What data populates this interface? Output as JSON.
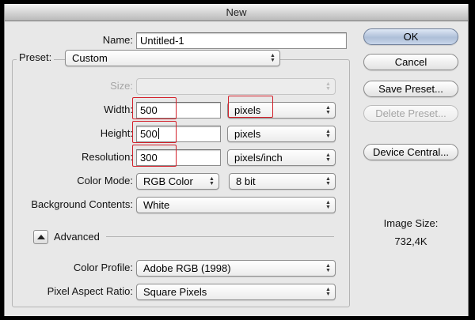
{
  "window": {
    "title": "New"
  },
  "name": {
    "label": "Name:",
    "value": "Untitled-1"
  },
  "preset": {
    "label": "Preset:",
    "value": "Custom"
  },
  "size": {
    "label": "Size:",
    "value": ""
  },
  "width": {
    "label": "Width:",
    "value": "500",
    "unit": "pixels"
  },
  "height": {
    "label": "Height:",
    "value": "500",
    "unit": "pixels"
  },
  "resolution": {
    "label": "Resolution:",
    "value": "300",
    "unit": "pixels/inch"
  },
  "color_mode": {
    "label": "Color Mode:",
    "mode": "RGB Color",
    "depth": "8 bit"
  },
  "background": {
    "label": "Background Contents:",
    "value": "White"
  },
  "advanced": {
    "label": "Advanced"
  },
  "color_profile": {
    "label": "Color Profile:",
    "value": "Adobe RGB (1998)"
  },
  "pixel_aspect": {
    "label": "Pixel Aspect Ratio:",
    "value": "Square Pixels"
  },
  "buttons": {
    "ok": "OK",
    "cancel": "Cancel",
    "save_preset": "Save Preset...",
    "delete_preset": "Delete Preset...",
    "device_central": "Device Central..."
  },
  "image_size": {
    "label": "Image Size:",
    "value": "732,4K"
  },
  "colors": {
    "highlight": "#d3202a",
    "dialog_bg": "#e8e8e8",
    "frame": "#000000"
  },
  "icons": {
    "popup_arrows": "up-down-arrows-icon",
    "advanced_toggle": "triangle-up-icon"
  }
}
